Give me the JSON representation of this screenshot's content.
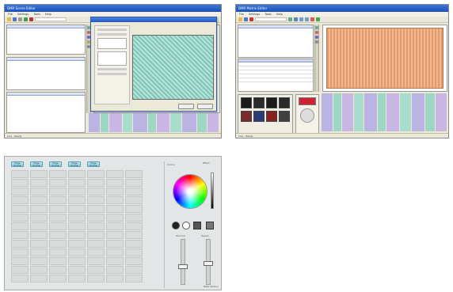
{
  "screenshot_editor": {
    "window_title": "DMX Scene Editor",
    "menu": [
      "File",
      "Settings",
      "Tools",
      "Help"
    ],
    "statusbar": [
      "Live",
      "Ready"
    ]
  },
  "screenshot_matrix": {
    "window_title": "DMX Matrix Editor",
    "menu": [
      "File",
      "Settings",
      "Tools",
      "Help"
    ],
    "statusbar": [
      "Live",
      "Ready"
    ]
  },
  "console": {
    "top_buttons": [
      {
        "top": "Page",
        "bottom": "Scene"
      },
      {
        "top": "Page",
        "bottom": "Scene"
      },
      {
        "top": "Page",
        "bottom": "Scene"
      },
      {
        "top": "Page",
        "bottom": "Scene"
      },
      {
        "top": "Page",
        "bottom": "Scene"
      }
    ],
    "side_title": "Colors",
    "side_header_right": "Effect",
    "fader_labels": [
      "Dimmer",
      "Speed"
    ],
    "footer_text": "Beta Version",
    "colors": {
      "panel": "#e3e6e6",
      "cell": "#d7dcdb",
      "button": "#a9d7e6"
    }
  },
  "icons": [
    "folder-icon",
    "save-icon",
    "print-icon",
    "play-icon",
    "stop-icon",
    "record-icon",
    "settings-icon"
  ]
}
